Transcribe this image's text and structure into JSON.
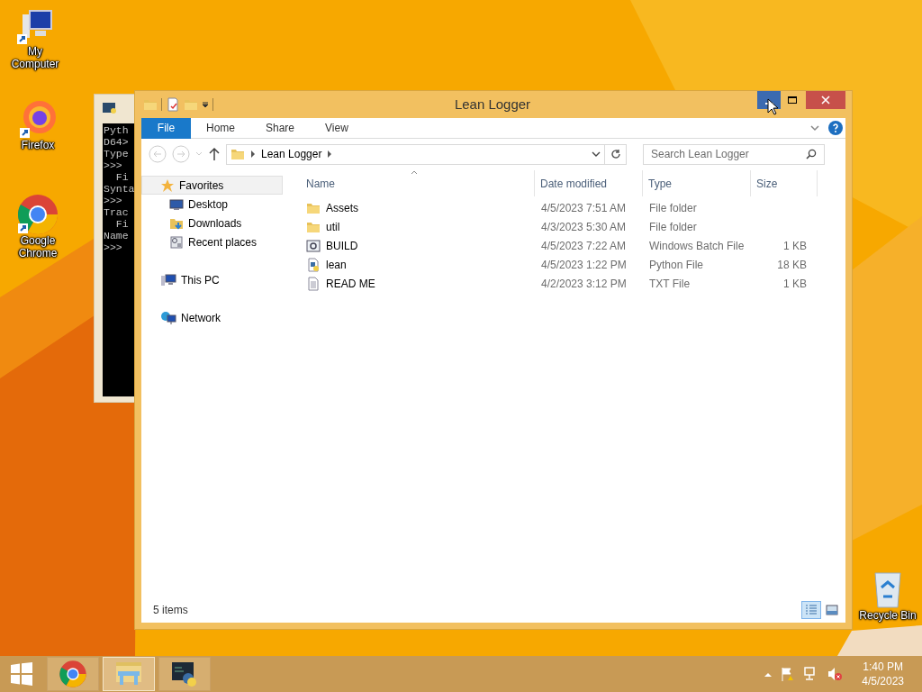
{
  "desktop_icons": [
    {
      "label": "My Computer",
      "kind": "computer"
    },
    {
      "label": "Firefox",
      "kind": "firefox"
    },
    {
      "label": "Google Chrome",
      "kind": "chrome"
    },
    {
      "label": "Recycle Bin",
      "kind": "recycle"
    }
  ],
  "console": {
    "lines": [
      "Pyth",
      "D64>",
      "Type",
      ">>>",
      "  Fi",
      "Synta",
      ">>>",
      "Trac",
      "  Fi",
      "Name",
      ">>>"
    ]
  },
  "explorer": {
    "title": "Lean Logger",
    "caption_buttons": [
      {
        "kind": "minimize",
        "highlighted": true
      },
      {
        "kind": "maximize",
        "highlighted": false
      },
      {
        "kind": "close",
        "highlighted": false
      }
    ],
    "ribbon_tabs": [
      {
        "label": "File",
        "selected": true
      },
      {
        "label": "Home",
        "selected": false
      },
      {
        "label": "Share",
        "selected": false
      },
      {
        "label": "View",
        "selected": false
      }
    ],
    "address": {
      "path": [
        "Lean Logger"
      ]
    },
    "search": {
      "placeholder": "Search Lean Logger"
    },
    "nav": [
      {
        "label": "Favorites",
        "kind": "star",
        "selected": true,
        "children": [
          {
            "label": "Desktop",
            "kind": "desktop",
            "selected": false
          },
          {
            "label": "Downloads",
            "kind": "downloads",
            "selected": false
          },
          {
            "label": "Recent places",
            "kind": "recent",
            "selected": false
          }
        ]
      },
      {
        "label": "This PC",
        "kind": "pc",
        "selected": false
      },
      {
        "label": "Network",
        "kind": "network",
        "selected": false
      }
    ],
    "columns": [
      "Name",
      "Date modified",
      "Type",
      "Size"
    ],
    "rows": [
      {
        "name": "Assets",
        "date": "4/5/2023 7:51 AM",
        "type": "File folder",
        "kind": "folder"
      },
      {
        "name": "util",
        "date": "4/3/2023 5:30 AM",
        "type": "File folder",
        "kind": "folder"
      },
      {
        "name": "BUILD",
        "date": "4/5/2023 7:22 AM",
        "type": "Windows Batch File",
        "size": "1 KB",
        "kind": "batch"
      },
      {
        "name": "lean",
        "date": "4/5/2023 1:22 PM",
        "type": "Python File",
        "size": "18 KB",
        "kind": "python"
      },
      {
        "name": "READ ME",
        "date": "4/2/2023 3:12 PM",
        "type": "TXT File",
        "size": "1 KB",
        "kind": "text"
      }
    ],
    "status": "5 items",
    "view_buttons": [
      {
        "kind": "details",
        "selected": true
      },
      {
        "kind": "large",
        "selected": false
      }
    ]
  },
  "taskbar": {
    "items": [
      {
        "kind": "start",
        "selected": false
      },
      {
        "kind": "chrome",
        "selected": false
      },
      {
        "kind": "explorer",
        "selected": true
      },
      {
        "kind": "python",
        "selected": false
      }
    ],
    "time": "1:40 PM",
    "date": "4/5/2023"
  }
}
